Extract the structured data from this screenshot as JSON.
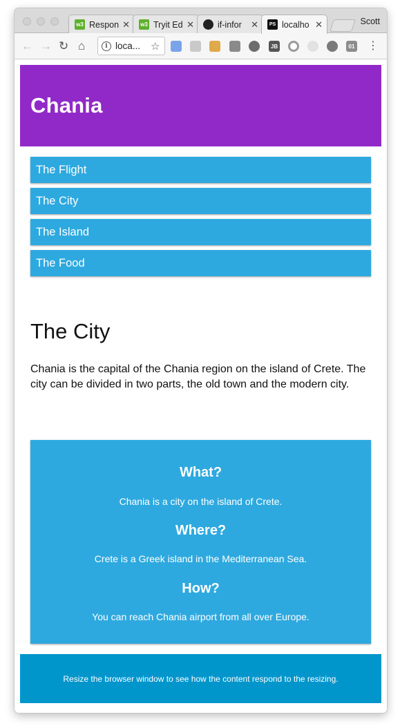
{
  "browser": {
    "tabs": [
      {
        "title": "Respon",
        "favicon": "w3schools-icon"
      },
      {
        "title": "Tryit Ed",
        "favicon": "w3schools-icon"
      },
      {
        "title": "if-infor",
        "favicon": "github-icon"
      },
      {
        "title": "localho",
        "favicon": "phpstorm-icon"
      }
    ],
    "close_glyph": "✕",
    "profile_name": "Scott",
    "address": "loca...",
    "favicon_labels": {
      "w3": "w3",
      "ps": "PS"
    },
    "extension_labels": {
      "jb": "JB",
      "counter": "01"
    }
  },
  "page": {
    "header_title": "Chania",
    "menu": [
      "The Flight",
      "The City",
      "The Island",
      "The Food"
    ],
    "main": {
      "title": "The City",
      "text": "Chania is the capital of the Chania region on the island of Crete. The city can be divided in two parts, the old town and the modern city."
    },
    "aside": {
      "items": [
        {
          "heading": "What?",
          "text": "Chania is a city on the island of Crete."
        },
        {
          "heading": "Where?",
          "text": "Crete is a Greek island in the Mediterranean Sea."
        },
        {
          "heading": "How?",
          "text": "You can reach Chania airport from all over Europe."
        }
      ]
    },
    "footer_text": "Resize the browser window to see how the content respond to the resizing."
  },
  "colors": {
    "header_bg": "#9129c8",
    "menu_bg": "#2ea9df",
    "aside_bg": "#2ea9df",
    "footer_bg": "#0096cc"
  }
}
